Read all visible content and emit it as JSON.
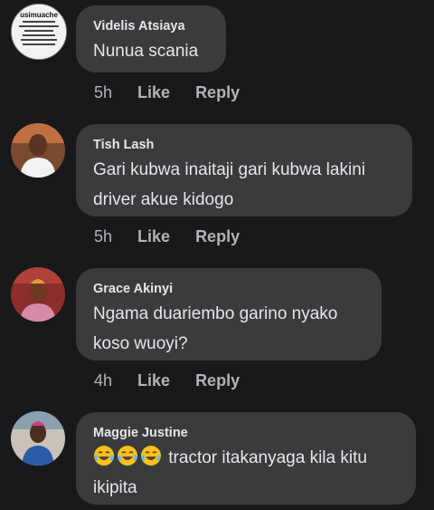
{
  "comments": [
    {
      "author": "Videlis Atsiaya",
      "text": "Nunua scania",
      "time": "5h",
      "like": "Like",
      "reply": "Reply",
      "avatar_caption": [
        "usimuache",
        "\"mwanaume\"",
        "Awanabadu hama huia",
        "bali muache",
        "\"mwanaume\"",
        "kwasababu hama",
        "hongo na mwanzi"
      ]
    },
    {
      "author": "Tish Lash",
      "text": "Gari kubwa inaitaji gari kubwa lakini driver akue kidogo",
      "time": "5h",
      "like": "Like",
      "reply": "Reply"
    },
    {
      "author": "Grace Akinyi",
      "text": "Ngama duariembo garino nyako koso wuoyi?",
      "time": "4h",
      "like": "Like",
      "reply": "Reply"
    },
    {
      "author": "Maggie Justine",
      "emoji": [
        "face-with-tears-of-joy",
        "face-with-tears-of-joy",
        "face-with-tears-of-joy"
      ],
      "text": "tractor itakanyaga kila kitu ikipita"
    }
  ],
  "colors": {
    "background": "#18191a",
    "bubble": "#3a3b3c",
    "text": "#e4e6eb",
    "meta": "#b0b3b8"
  }
}
